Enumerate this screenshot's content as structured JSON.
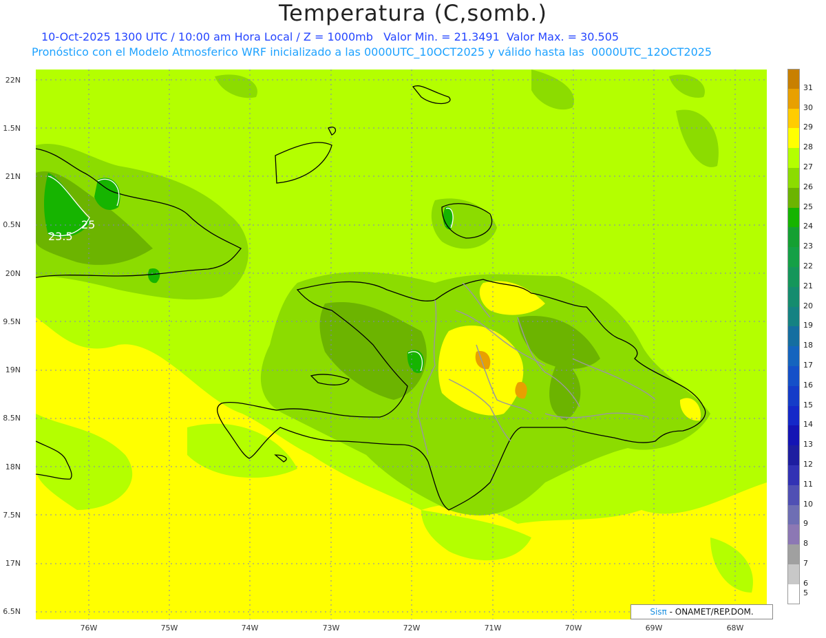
{
  "title": "Temperatura (C,somb.)",
  "subtitle_line1": "10-Oct-2025 1300 UTC / 10:00 am Hora Local / Z = 1000mb   Valor Min. = 21.3491  Valor Max. = 30.505",
  "subtitle_line2": "Pronóstico con el Modelo Atmosferico WRF inicializado a las 0000UTC_10OCT2025 y válido hasta las  0000UTC_12OCT2025",
  "y_axis": [
    "22N",
    "1.5N",
    "21N",
    "0.5N",
    "20N",
    "9.5N",
    "19N",
    "8.5N",
    "18N",
    "7.5N",
    "17N",
    "6.5N"
  ],
  "x_axis": [
    "76W",
    "75W",
    "74W",
    "73W",
    "72W",
    "71W",
    "70W",
    "69W",
    "68W"
  ],
  "colorbar": {
    "labels": [
      "31",
      "30",
      "29",
      "28",
      "27",
      "26",
      "25",
      "24",
      "23",
      "22",
      "21",
      "20",
      "19",
      "18",
      "17",
      "16",
      "15",
      "14",
      "13",
      "12",
      "11",
      "10",
      "9",
      "8",
      "7",
      "6",
      "5"
    ],
    "colors": [
      "#c88000",
      "#e8a000",
      "#ffcc00",
      "#ffff00",
      "#b4ff00",
      "#8cdc00",
      "#6cb400",
      "#16b400",
      "#14a032",
      "#14a046",
      "#14965a",
      "#148c6e",
      "#148282",
      "#146ea0",
      "#1464be",
      "#1450c8",
      "#143cc8",
      "#1428c8",
      "#1414b4",
      "#1e1ea0",
      "#3232b4",
      "#5050b4",
      "#6e6eb4",
      "#8c78b4",
      "#a0a0a0",
      "#c8c8c8",
      "#ffffff"
    ]
  },
  "contour_labels": [
    "23.5",
    "25"
  ],
  "credit_sis": "Sisπ",
  "credit_text": "- ONAMET/REP.DOM."
}
